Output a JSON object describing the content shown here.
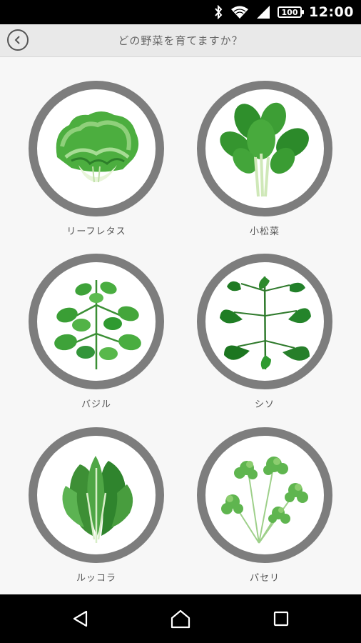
{
  "status_bar": {
    "time": "12:00",
    "battery": "100",
    "icons": [
      "bluetooth-icon",
      "wifi-icon",
      "signal-icon",
      "battery-icon"
    ]
  },
  "header": {
    "title": "どの野菜を育てますか？",
    "back_icon": "back-arrow-icon"
  },
  "vegetables": [
    {
      "label": "リーフレタス",
      "icon": "leaf-lettuce-image"
    },
    {
      "label": "小松菜",
      "icon": "komatsuna-image"
    },
    {
      "label": "バジル",
      "icon": "basil-image"
    },
    {
      "label": "シソ",
      "icon": "shiso-image"
    },
    {
      "label": "ルッコラ",
      "icon": "arugula-image"
    },
    {
      "label": "パセリ",
      "icon": "parsley-image"
    }
  ],
  "nav_bar": {
    "icons": [
      "back-triangle-icon",
      "home-icon",
      "recents-icon"
    ]
  },
  "colors": {
    "ring": "#7d7d7d",
    "leaf_green": "#3f9a3a",
    "background": "#f7f7f7"
  }
}
